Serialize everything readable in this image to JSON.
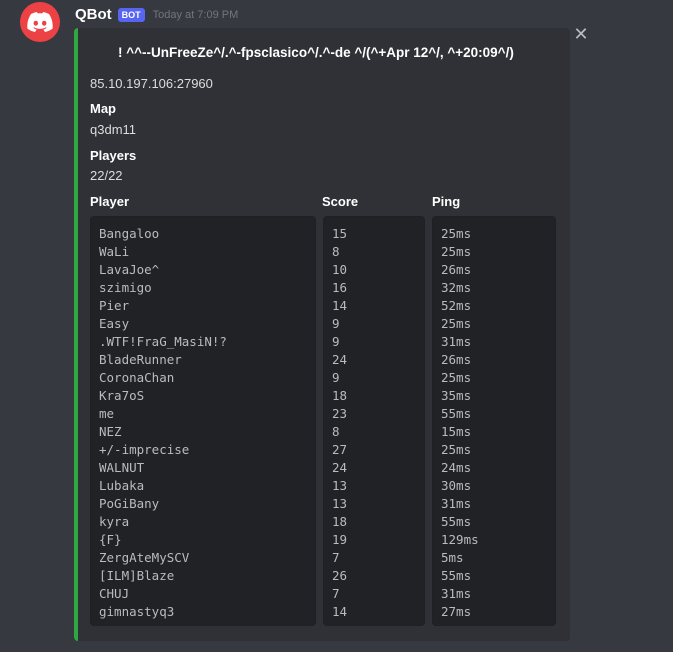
{
  "message": {
    "username": "QBot",
    "bot_tag": "BOT",
    "timestamp": "Today at 7:09 PM",
    "avatar_icon": "discord-logo-icon",
    "avatar_color": "#ed4245"
  },
  "embed": {
    "accent_color": "#2fa842",
    "title": "! ^^--UnFreeZe^/.^-fpsclasico^/.^-de ^/(^+Apr 12^/, ^+20:09^/)",
    "description": "85.10.197.106:27960",
    "fields": {
      "map": {
        "name": "Map",
        "value": "q3dm11"
      },
      "players": {
        "name": "Players",
        "value": "22/22"
      }
    },
    "columns": {
      "player": "Player",
      "score": "Score",
      "ping": "Ping"
    },
    "players": [
      "Bangaloo",
      "WaLi",
      "LavaJoe^",
      "szimigo",
      "Pier",
      "Easy",
      ".WTF!FraG_MasiN!?",
      "BladeRunner",
      "CoronaChan",
      "Kra7oS",
      "me",
      "NEZ",
      "+/-imprecise",
      "WALNUT",
      "Lubaka",
      "PoGiBany",
      "kyra",
      "{F}",
      "ZergAteMySCV",
      "[ILM]Blaze",
      "CHUJ",
      "gimnastyq3"
    ],
    "scores": [
      "15",
      "8",
      "10",
      "16",
      "14",
      "9",
      "9",
      "24",
      "9",
      "18",
      "23",
      "8",
      "27",
      "24",
      "13",
      "13",
      "18",
      "19",
      "7",
      "26",
      "7",
      "14"
    ],
    "pings": [
      "25ms",
      "25ms",
      "26ms",
      "32ms",
      "52ms",
      "25ms",
      "31ms",
      "26ms",
      "25ms",
      "35ms",
      "55ms",
      "15ms",
      "25ms",
      "24ms",
      "30ms",
      "31ms",
      "55ms",
      "129ms",
      "5ms",
      "55ms",
      "31ms",
      "27ms"
    ],
    "close_icon": "close-icon"
  }
}
